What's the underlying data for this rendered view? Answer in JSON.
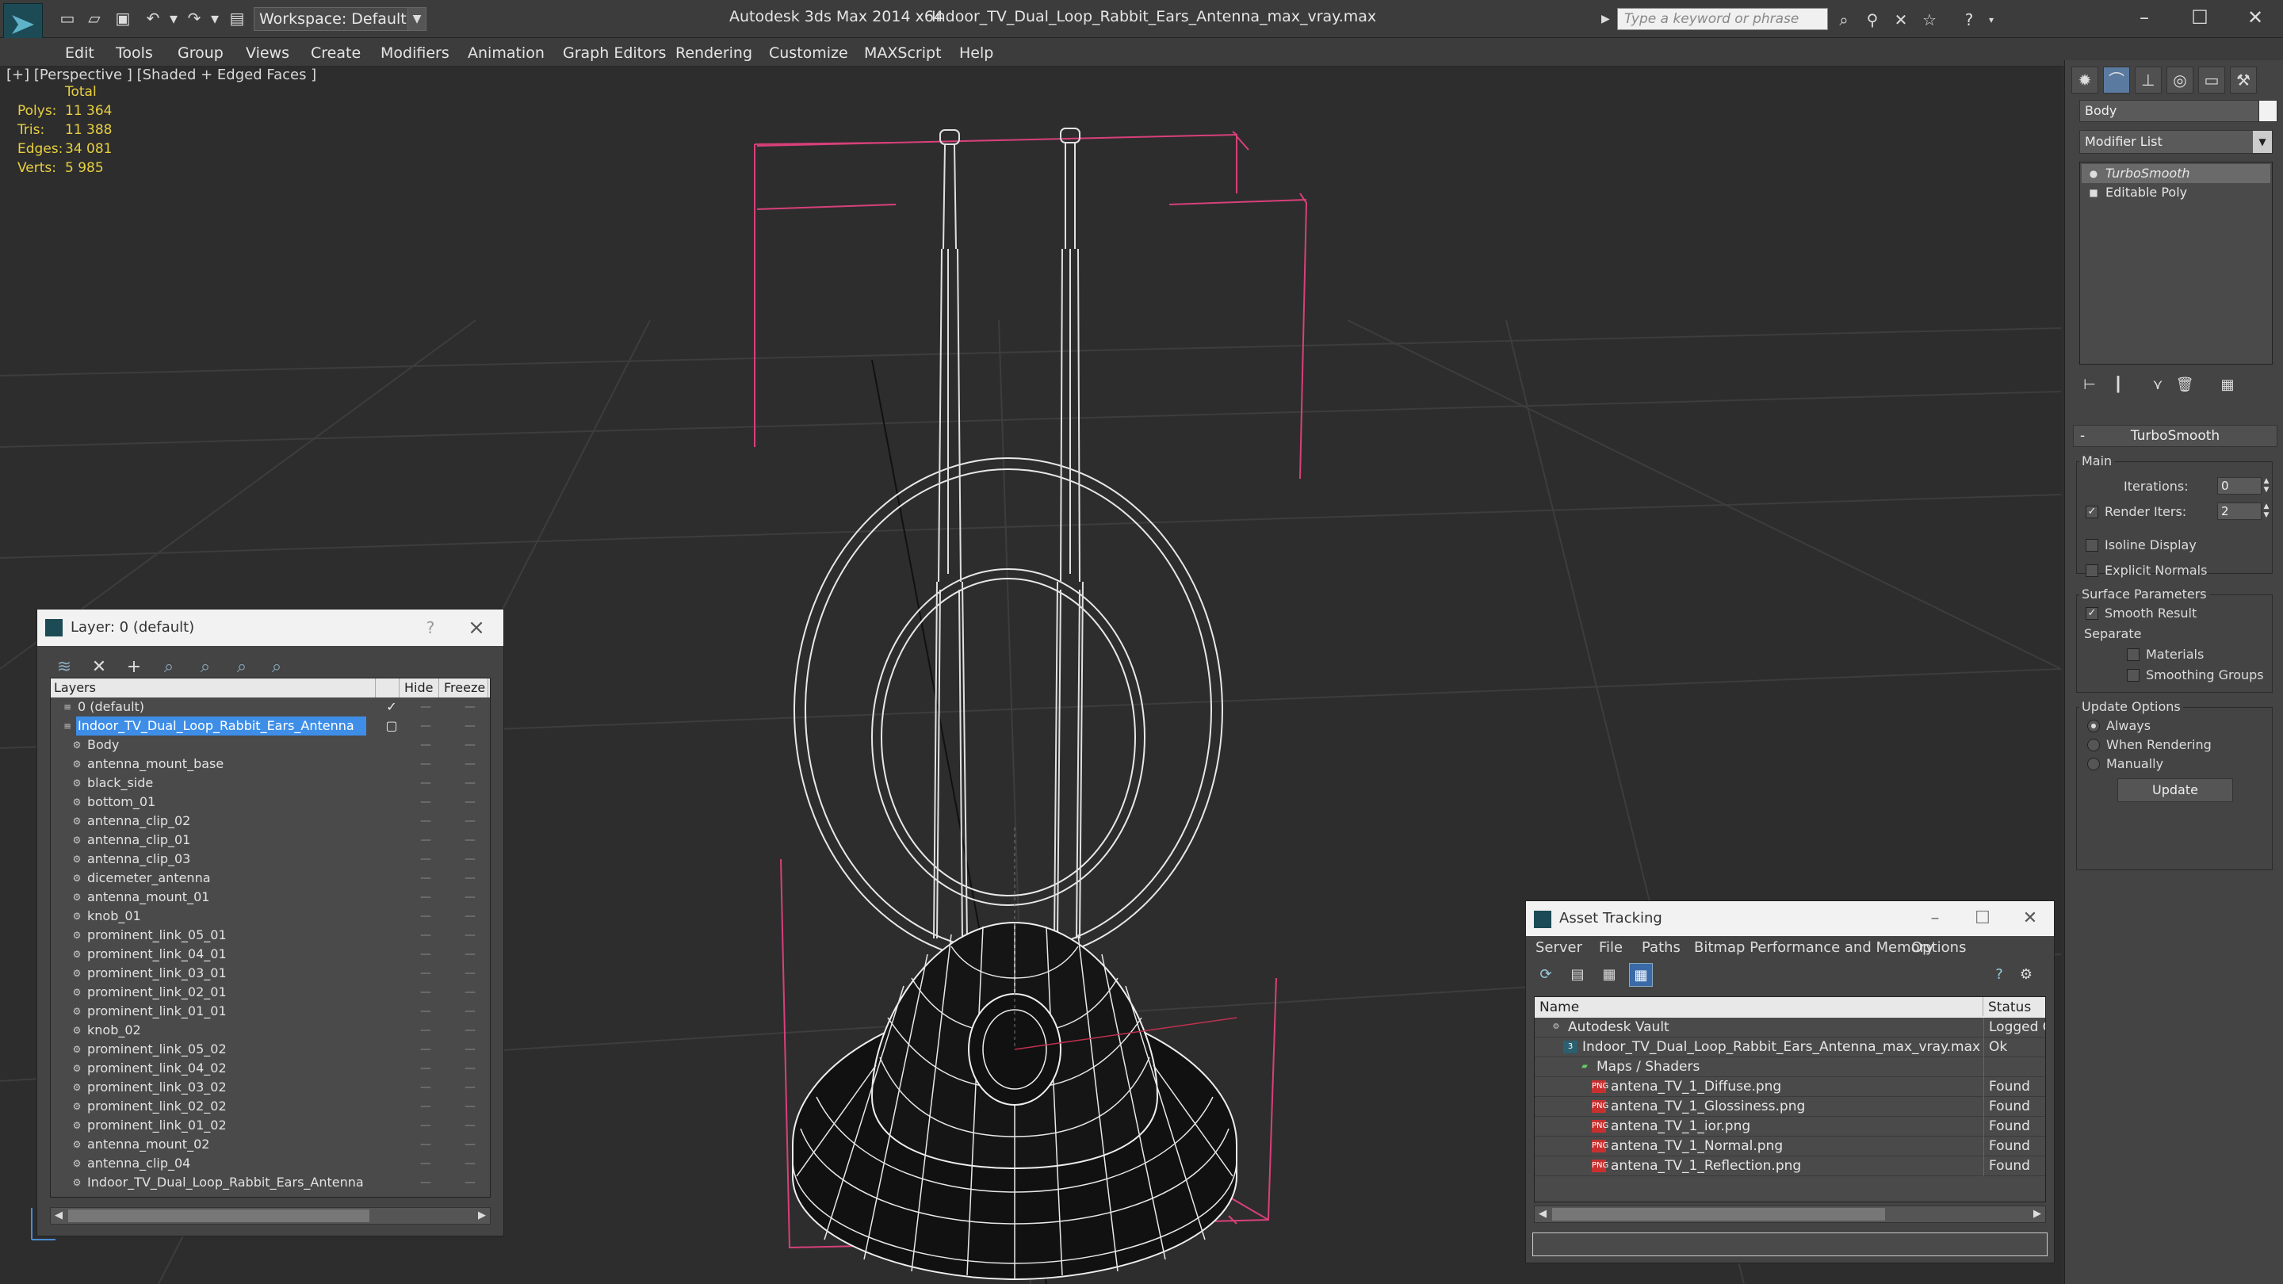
{
  "titlebar": {
    "workspace": "Workspace: Default",
    "app_title": "Autodesk 3ds Max  2014 x64",
    "file_title": "Indoor_TV_Dual_Loop_Rabbit_Ears_Antenna_max_vray.max",
    "search_placeholder": "Type a keyword or phrase"
  },
  "menu": [
    "Edit",
    "Tools",
    "Group",
    "Views",
    "Create",
    "Modifiers",
    "Animation",
    "Graph Editors",
    "Rendering",
    "Customize",
    "MAXScript",
    "Help"
  ],
  "viewport": {
    "label": "[+] [Perspective ] [Shaded + Edged Faces ]",
    "stats_header": "Total",
    "stats": [
      {
        "label": "Polys:",
        "value": "11 364"
      },
      {
        "label": "Tris:",
        "value": "11 388"
      },
      {
        "label": "Edges:",
        "value": "34 081"
      },
      {
        "label": "Verts:",
        "value": "5 985"
      }
    ]
  },
  "command_panel": {
    "object_name": "Body",
    "modifier_list": "Modifier List",
    "stack": [
      "TurboSmooth",
      "Editable Poly"
    ],
    "rollout": {
      "title": "TurboSmooth",
      "main": "Main",
      "iterations_label": "Iterations:",
      "iterations": "0",
      "render_iters_label": "Render Iters:",
      "render_iters": "2",
      "isoline": "Isoline Display",
      "explicit_normals": "Explicit Normals",
      "surface_params": "Surface Parameters",
      "smooth_result": "Smooth Result",
      "separate": "Separate",
      "materials": "Materials",
      "smoothing_groups": "Smoothing Groups",
      "update_options": "Update Options",
      "always": "Always",
      "when_rendering": "When Rendering",
      "manually": "Manually",
      "update_button": "Update"
    }
  },
  "layer_panel": {
    "title": "Layer: 0 (default)",
    "help": "?",
    "col_layers": "Layers",
    "col_hide": "Hide",
    "col_freeze": "Freeze",
    "rows": [
      {
        "name": "0 (default)",
        "level": 0
      },
      {
        "name": "Indoor_TV_Dual_Loop_Rabbit_Ears_Antenna",
        "level": 0
      },
      {
        "name": "Body",
        "level": 1
      },
      {
        "name": "antenna_mount_base",
        "level": 1
      },
      {
        "name": "black_side",
        "level": 1
      },
      {
        "name": "bottom_01",
        "level": 1
      },
      {
        "name": "antenna_clip_02",
        "level": 1
      },
      {
        "name": "antenna_clip_01",
        "level": 1
      },
      {
        "name": "antenna_clip_03",
        "level": 1
      },
      {
        "name": "dicemeter_antenna",
        "level": 1
      },
      {
        "name": "antenna_mount_01",
        "level": 1
      },
      {
        "name": "knob_01",
        "level": 1
      },
      {
        "name": "prominent_link_05_01",
        "level": 1
      },
      {
        "name": "prominent_link_04_01",
        "level": 1
      },
      {
        "name": "prominent_link_03_01",
        "level": 1
      },
      {
        "name": "prominent_link_02_01",
        "level": 1
      },
      {
        "name": "prominent_link_01_01",
        "level": 1
      },
      {
        "name": "knob_02",
        "level": 1
      },
      {
        "name": "prominent_link_05_02",
        "level": 1
      },
      {
        "name": "prominent_link_04_02",
        "level": 1
      },
      {
        "name": "prominent_link_03_02",
        "level": 1
      },
      {
        "name": "prominent_link_02_02",
        "level": 1
      },
      {
        "name": "prominent_link_01_02",
        "level": 1
      },
      {
        "name": "antenna_mount_02",
        "level": 1
      },
      {
        "name": "antenna_clip_04",
        "level": 1
      },
      {
        "name": "Indoor_TV_Dual_Loop_Rabbit_Ears_Antenna",
        "level": 1
      }
    ]
  },
  "asset_panel": {
    "title": "Asset Tracking",
    "menu": [
      "Server",
      "File",
      "Paths",
      "Bitmap Performance and Memory",
      "Options"
    ],
    "col_name": "Name",
    "col_status": "Status",
    "rows": [
      {
        "name": "Autodesk Vault",
        "status": "Logged O",
        "level": 0,
        "icon": "vault"
      },
      {
        "name": "Indoor_TV_Dual_Loop_Rabbit_Ears_Antenna_max_vray.max",
        "status": "Ok",
        "level": 1,
        "icon": "max"
      },
      {
        "name": "Maps / Shaders",
        "status": "",
        "level": 2,
        "icon": "maps"
      },
      {
        "name": "antena_TV_1_Diffuse.png",
        "status": "Found",
        "level": 3,
        "icon": "png"
      },
      {
        "name": "antena_TV_1_Glossiness.png",
        "status": "Found",
        "level": 3,
        "icon": "png"
      },
      {
        "name": "antena_TV_1_ior.png",
        "status": "Found",
        "level": 3,
        "icon": "png"
      },
      {
        "name": "antena_TV_1_Normal.png",
        "status": "Found",
        "level": 3,
        "icon": "png"
      },
      {
        "name": "antena_TV_1_Reflection.png",
        "status": "Found",
        "level": 3,
        "icon": "png"
      }
    ]
  },
  "colors": {
    "selection_blue": "#3e8ee8",
    "stats_yellow": "#e8d040",
    "bbox_pink": "#e05080",
    "png_red": "#c83030"
  }
}
